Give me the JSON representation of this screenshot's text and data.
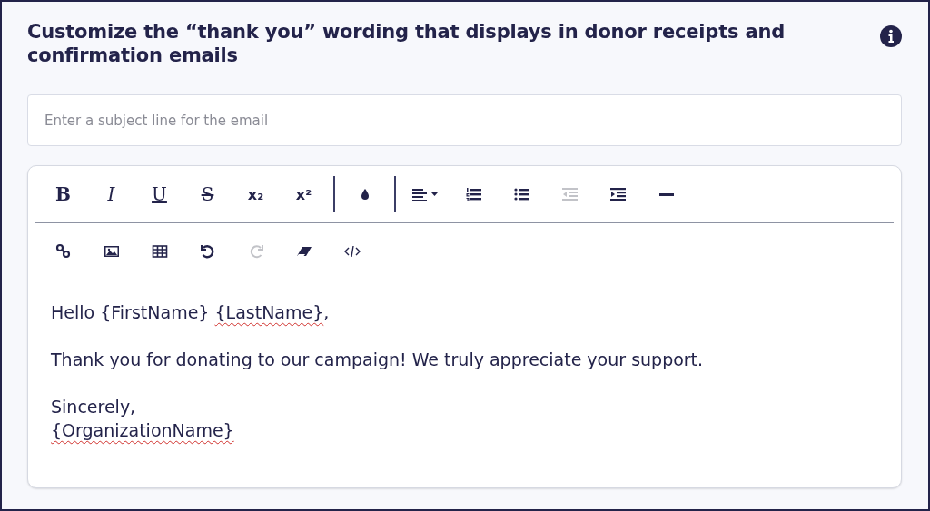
{
  "title": "Customize the “thank you” wording that displays in donor receipts and confirmation emails",
  "subject": {
    "placeholder": "Enter a subject line for the email"
  },
  "toolbar": [
    [
      {
        "kind": "text",
        "label": "B"
      },
      {
        "kind": "text",
        "label": "I"
      },
      {
        "kind": "text",
        "label": "U"
      },
      {
        "kind": "text",
        "label": "S"
      },
      {
        "kind": "text",
        "label": "x₂"
      },
      {
        "kind": "text",
        "label": "x²"
      },
      {
        "kind": "divider"
      },
      {
        "kind": "icon",
        "disabled": false
      },
      {
        "kind": "divider"
      },
      {
        "kind": "icon",
        "disabled": false
      },
      {
        "kind": "icon",
        "disabled": false
      },
      {
        "kind": "icon",
        "disabled": false
      },
      {
        "kind": "icon",
        "disabled": true
      },
      {
        "kind": "icon",
        "disabled": false
      },
      {
        "kind": "icon",
        "disabled": false
      }
    ],
    [
      {
        "kind": "icon",
        "disabled": false
      },
      {
        "kind": "icon",
        "disabled": false
      },
      {
        "kind": "icon",
        "disabled": false
      },
      {
        "kind": "icon",
        "disabled": false
      },
      {
        "kind": "icon",
        "disabled": true
      },
      {
        "kind": "icon",
        "disabled": false
      },
      {
        "kind": "icon",
        "disabled": false
      }
    ]
  ],
  "body": [
    {
      "lines": [
        [
          {
            "text": "Hello {FirstName} "
          },
          {
            "text": "{LastName}",
            "misspelled": true
          },
          {
            "text": ","
          }
        ]
      ]
    },
    {
      "lines": [
        [
          {
            "text": "Thank you for donating to our campaign! We truly appreciate your support."
          }
        ]
      ]
    },
    {
      "lines": [
        [
          {
            "text": "Sincerely,"
          }
        ],
        [
          {
            "text": "{OrganizationName}",
            "misspelled": true
          }
        ]
      ]
    }
  ]
}
